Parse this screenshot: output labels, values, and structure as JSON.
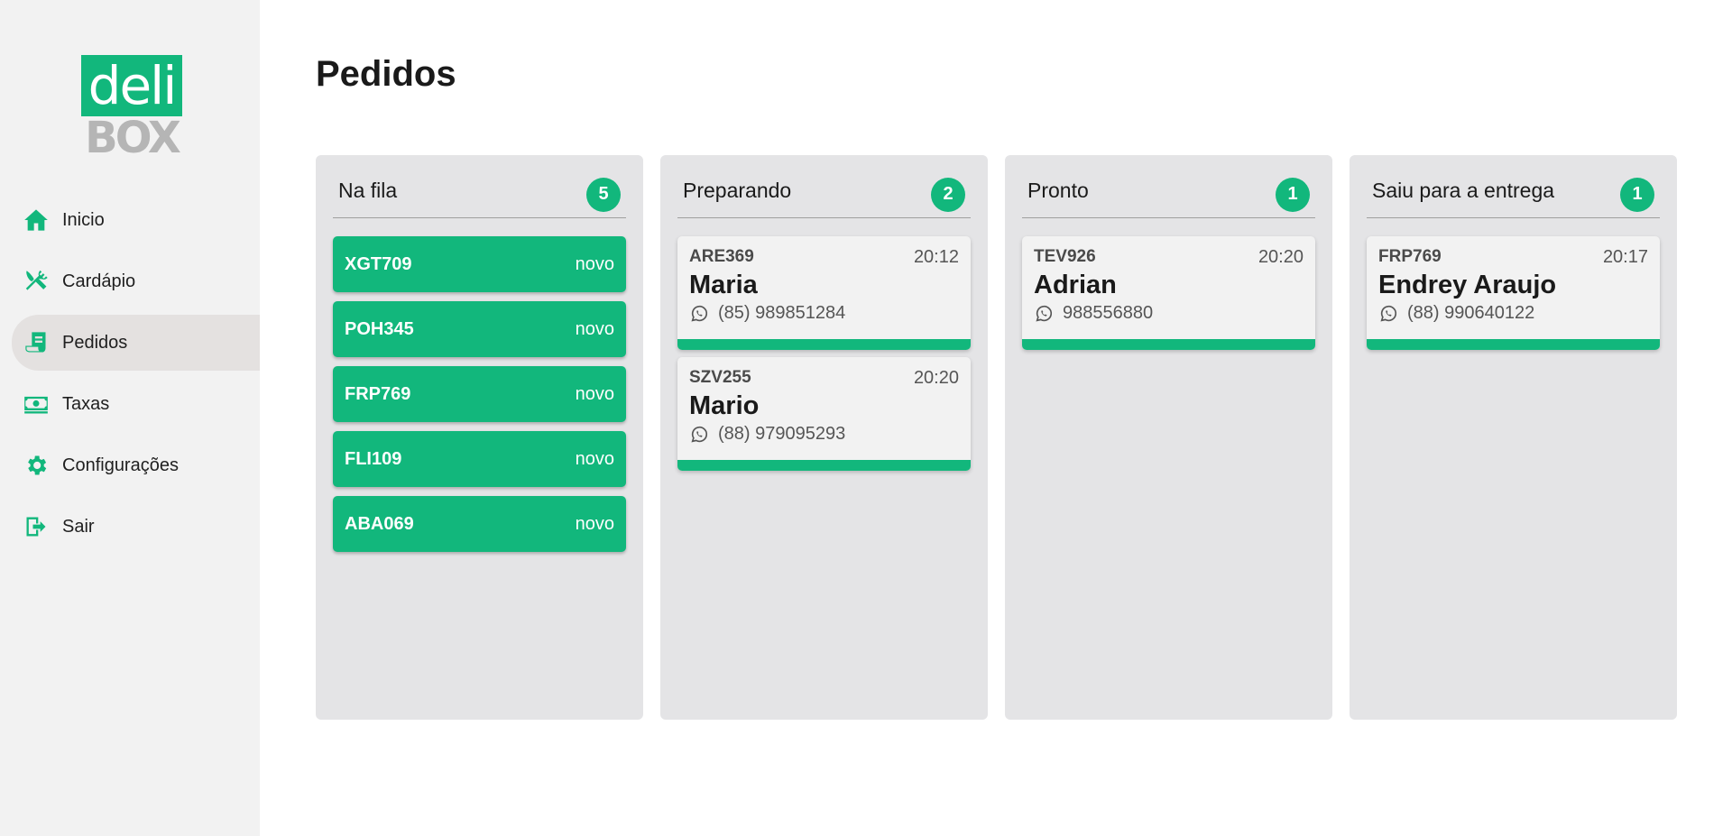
{
  "brand": {
    "logo_top": "deli",
    "logo_bottom": "BOX",
    "accent": "#12b77c"
  },
  "sidebar": {
    "items": [
      {
        "label": "Inicio",
        "icon": "home-icon"
      },
      {
        "label": "Cardápio",
        "icon": "utensils-icon"
      },
      {
        "label": "Pedidos",
        "icon": "receipt-icon",
        "active": true
      },
      {
        "label": "Taxas",
        "icon": "money-icon"
      },
      {
        "label": "Configurações",
        "icon": "gear-icon"
      },
      {
        "label": "Sair",
        "icon": "logout-icon"
      }
    ]
  },
  "page": {
    "title": "Pedidos"
  },
  "columns": [
    {
      "title": "Na fila",
      "count": "5",
      "queue": [
        {
          "code": "XGT709",
          "status": "novo"
        },
        {
          "code": "POH345",
          "status": "novo"
        },
        {
          "code": "FRP769",
          "status": "novo"
        },
        {
          "code": "FLI109",
          "status": "novo"
        },
        {
          "code": "ABA069",
          "status": "novo"
        }
      ]
    },
    {
      "title": "Preparando",
      "count": "2",
      "orders": [
        {
          "code": "ARE369",
          "time": "20:12",
          "name": "Maria",
          "phone": "(85) 989851284"
        },
        {
          "code": "SZV255",
          "time": "20:20",
          "name": "Mario",
          "phone": "(88) 979095293"
        }
      ]
    },
    {
      "title": "Pronto",
      "count": "1",
      "orders": [
        {
          "code": "TEV926",
          "time": "20:20",
          "name": "Adrian",
          "phone": "988556880"
        }
      ]
    },
    {
      "title": "Saiu para a entrega",
      "count": "1",
      "orders": [
        {
          "code": "FRP769",
          "time": "20:17",
          "name": "Endrey Araujo",
          "phone": "(88) 990640122"
        }
      ]
    }
  ]
}
